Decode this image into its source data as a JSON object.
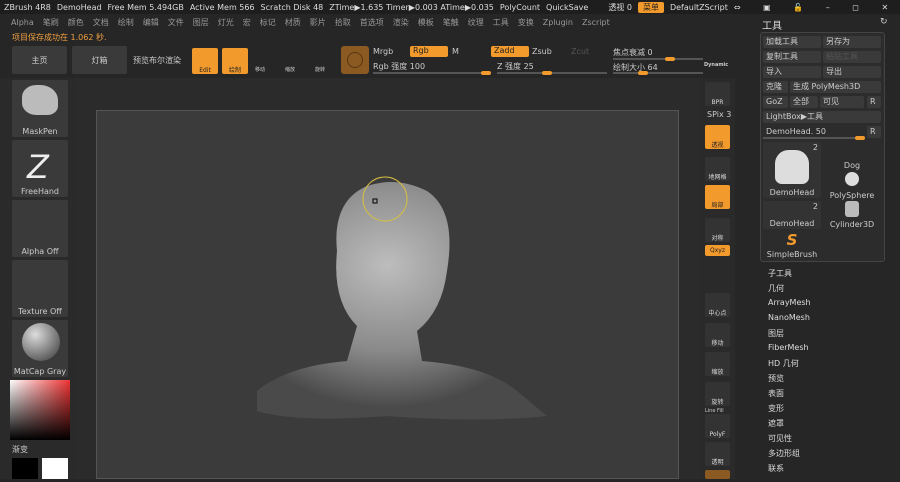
{
  "titlebar": {
    "app": "ZBrush 4R8",
    "doc": "DemoHead",
    "free_mem": "Free Mem 5.494GB",
    "active_mem": "Active Mem 566",
    "scratch": "Scratch Disk 48",
    "ztime": "ZTime▶1.635 Timer▶0.003 ATime▶0.035",
    "polycount": "PolyCount",
    "quicksave": "QuickSave",
    "transparency": "透视 0",
    "menu": "菜单",
    "script": "DefaultZScript"
  },
  "menus": [
    "Alpha",
    "笔刷",
    "颜色",
    "文档",
    "绘制",
    "编辑",
    "文件",
    "图层",
    "灯光",
    "宏",
    "标记",
    "材质",
    "影片",
    "拾取",
    "首选项",
    "渲染",
    "模板",
    "笔触",
    "纹理",
    "工具",
    "变换",
    "Zplugin",
    "Zscript"
  ],
  "status": "项目保存成功在 1.062 秒.",
  "toolbar": {
    "home": "主页",
    "lightbox": "灯箱",
    "bpr": "预览布尔渲染",
    "edit": "Edit",
    "draw": "绘制",
    "move": "移动",
    "scale": "缩放",
    "rotate": "旋转",
    "mrgb": "Mrgb",
    "rgb": "Rgb",
    "m": "M",
    "zadd": "Zadd",
    "zsub": "Zsub",
    "zcut": "Zcut",
    "rgb_intensity": "Rgb 强度 100",
    "z_intensity": "Z 强度 25",
    "focal": "焦点衰减 0",
    "draw_size": "绘制大小 64",
    "dynamic": "Dynamic"
  },
  "sliders": {
    "rgb_intensity": 100,
    "z_intensity": 25,
    "focal": 0,
    "draw_size": 64,
    "transparency": 0,
    "spix": 3,
    "demohead": 50
  },
  "left_shelf": {
    "brush": "MaskPen",
    "stroke": "FreeHand",
    "alpha": "Alpha Off",
    "texture": "Texture Off",
    "material": "MatCap Gray",
    "gradient": "渐变"
  },
  "right_shelf": {
    "bpr": "BPR",
    "spix": "SPix 3",
    "persp": "透视",
    "floor": "地网格",
    "local": "局部",
    "frame": "对称",
    "xyz": "Qxyz",
    "center": "中心点",
    "move": "移动",
    "scale": "缩放",
    "rotate": "旋转",
    "linefill": "Line Fill",
    "polyf": "PolyF",
    "transp": "透明"
  },
  "tool": {
    "title": "工具",
    "load": "加载工具",
    "saveas": "另存为",
    "copy": "复制工具",
    "paste": "粘贴工具",
    "import": "导入",
    "export": "导出",
    "clone": "克隆",
    "make_polymesh": "生成 PolyMesh3D",
    "goz": "GoZ",
    "all": "全部",
    "visible": "可见",
    "r": "R",
    "lightbox": "LightBox▶工具",
    "demohead_slider": "DemoHead. 50",
    "thumbs": [
      {
        "name": "DemoHead",
        "count": "2"
      },
      {
        "name": "Dog"
      },
      {
        "name": "PolySphere"
      },
      {
        "name": "DemoHead",
        "count": "2"
      },
      {
        "name": "Cylinder3D"
      },
      {
        "name": "SimpleBrush"
      }
    ],
    "subpalettes": [
      "子工具",
      "几何",
      "ArrayMesh",
      "NanoMesh",
      "图层",
      "FiberMesh",
      "HD 几何",
      "预览",
      "表面",
      "变形",
      "遮罩",
      "可见性",
      "多边形组",
      "联系"
    ]
  },
  "colors": {
    "accent": "#f39a2c",
    "canvas": "#3b3b3b",
    "bg": "#262626"
  }
}
